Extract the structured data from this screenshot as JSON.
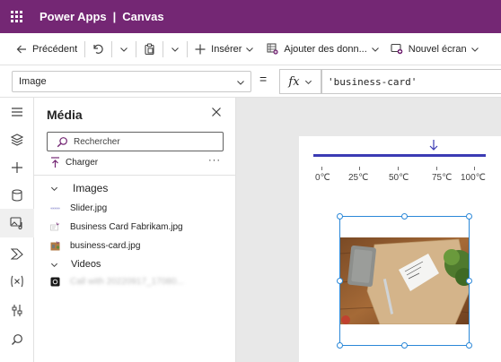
{
  "titlebar": {
    "app_name": "Power Apps",
    "separator": "|",
    "document": "Canvas"
  },
  "commands": {
    "back": "Précédent",
    "insert": "Insérer",
    "add_data": "Ajouter des donn...",
    "new_screen": "Nouvel écran"
  },
  "formula_bar": {
    "property": "Image",
    "equals": "=",
    "fx": "fx",
    "formula": "'business-card'"
  },
  "media_panel": {
    "title": "Média",
    "search_placeholder": "Rechercher",
    "upload": "Charger",
    "more": "···",
    "images_section": "Images",
    "images": [
      "Slider.jpg",
      "Business Card Fabrikam.jpg",
      "business-card.jpg"
    ],
    "videos_section": "Videos",
    "video_item": "Call with 20220917_17080..."
  },
  "slider": {
    "ticks": [
      "0℃",
      "25℃",
      "50℃",
      "75℃",
      "100℃"
    ]
  },
  "colors": {
    "brand": "#742774",
    "selection": "#2b88d8",
    "slider_rail": "#3b3bb4"
  }
}
